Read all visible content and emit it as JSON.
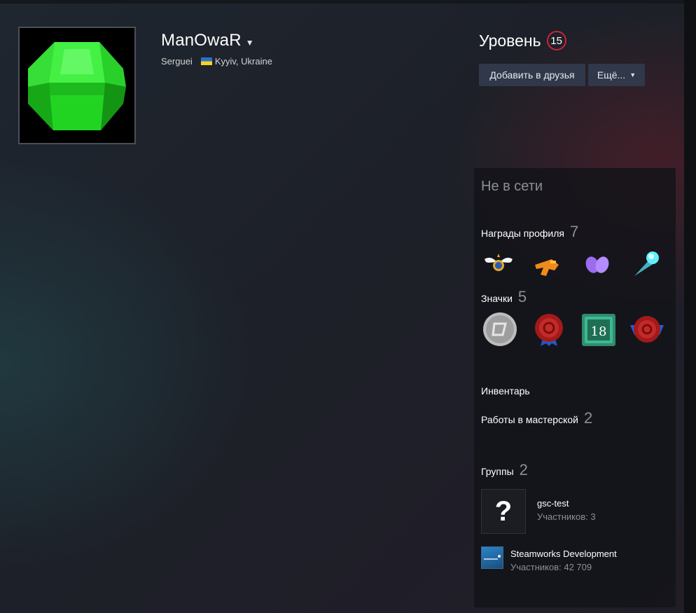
{
  "profile": {
    "persona_name": "ManOwaR",
    "real_name": "Serguei",
    "location": "Kyyiv, Ukraine"
  },
  "level": {
    "label": "Уровень",
    "value": "15"
  },
  "actions": {
    "add_friend": "Добавить в друзья",
    "more": "Ещё..."
  },
  "sidebar": {
    "status": "Не в сети",
    "awards": {
      "title": "Награды профиля",
      "count": "7"
    },
    "badges": {
      "title": "Значки",
      "count": "5"
    },
    "inventory": {
      "title": "Инвентарь"
    },
    "workshop": {
      "title": "Работы в мастерской",
      "count": "2"
    },
    "groups": {
      "title": "Группы",
      "count": "2",
      "items": [
        {
          "icon_text": "?",
          "name": "gsc-test",
          "members": "Участников: 3"
        },
        {
          "name": "Steamworks Development",
          "members": "Участников: 42 709"
        }
      ]
    }
  },
  "colors": {
    "level_ring": "#c8253a",
    "button_bg": "#30384a",
    "avatar_gem": "#2fe02f"
  }
}
